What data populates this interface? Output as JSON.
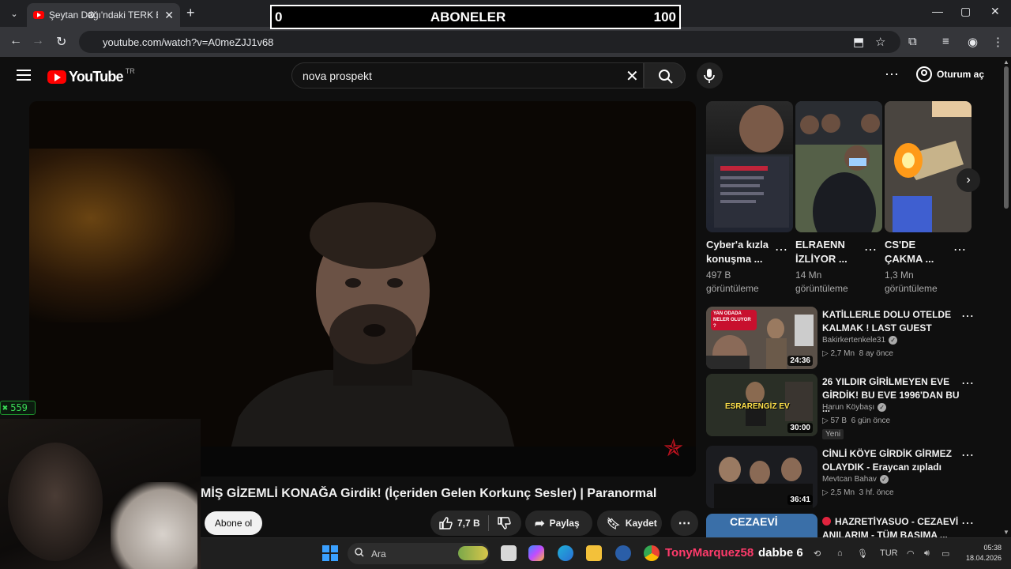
{
  "browser": {
    "tab_title": "Şeytan Dağı'ndaki TERK EDİLMİ",
    "url": "youtube.com/watch?v=A0meZJJ1v68"
  },
  "overlay_bar": {
    "left": "0",
    "label": "ABONELER",
    "right": "100"
  },
  "masthead": {
    "logo_text": "YouTube",
    "country": "TR",
    "search_value": "nova prospekt",
    "signin_label": "Oturum aç"
  },
  "video": {
    "title": "MİŞ GİZEMLİ KONAĞA Girdik! (İçeriden Gelen Korkunç Sesler) | Paranormal",
    "subscribe_label": "Abone ol",
    "like_count": "7,7 B",
    "share_label": "Paylaş",
    "save_label": "Kaydet"
  },
  "stream_overlay": {
    "counter": "559",
    "chat_name": "TonyMarquez58",
    "chat_message": "dabbe 6"
  },
  "shorts": [
    {
      "title": "Cyber'a kızla konuşma ...",
      "views": "497 B görüntüleme"
    },
    {
      "title": "ELRAENN İZLİYOR ...",
      "views": "14 Mn görüntüleme"
    },
    {
      "title": "CS'DE ÇAKMA ...",
      "views": "1,3 Mn görüntüleme"
    }
  ],
  "recommendations": [
    {
      "title": "KATİLLERLE DOLU OTELDE KALMAK ! LAST GUEST",
      "channel": "Bakirkertenkele31",
      "views": "2,7 Mn",
      "age": "8 ay önce",
      "duration": "24:36",
      "badge": "",
      "thumb_text": "YAN ODADA NELER OLUYOR ?"
    },
    {
      "title": "26 YILDIR GİRİLMEYEN EVE GİRDİK! BU EVE 1996'DAN BU ...",
      "channel": "Harun Köybaşı",
      "views": "57 B",
      "age": "6 gün önce",
      "duration": "30:00",
      "badge": "Yeni",
      "thumb_text": "ESRARENGİZ EV"
    },
    {
      "title": "CİNLİ KÖYE GİRDİK GİRMEZ OLAYDIK - Eraycan zıpladı",
      "channel": "Mevtcan Bahav",
      "views": "2,5 Mn",
      "age": "3 hf. önce",
      "duration": "36:41",
      "badge": "",
      "thumb_text": ""
    },
    {
      "title": "HAZRETİYASUO - CEZAEVİ ANILARIM - TÜM BAŞIMA ...",
      "channel": "",
      "views": "",
      "age": "",
      "duration": "",
      "badge": "",
      "thumb_text": "CEZAEVİ"
    }
  ],
  "taskbar": {
    "search_placeholder": "Ara",
    "lang": "TUR",
    "time": "05:38",
    "date": "18.04.2026"
  },
  "colors": {
    "yt_red": "#ff0000",
    "background": "#0f0f0f",
    "chat_name": "#ff3b6b",
    "counter_green": "#3adb57"
  }
}
